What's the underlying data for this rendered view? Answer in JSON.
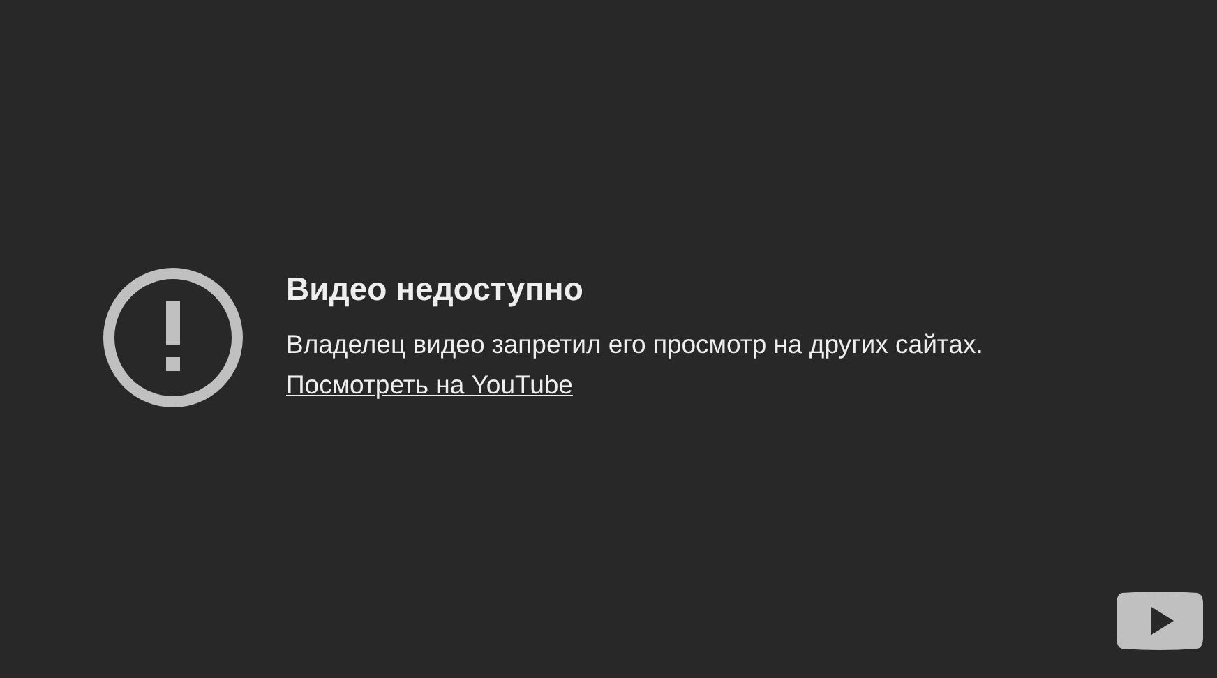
{
  "error": {
    "title": "Видео недоступно",
    "message": "Владелец видео запретил его просмотр на других сайтах.",
    "link": "Посмотреть на YouTube"
  }
}
